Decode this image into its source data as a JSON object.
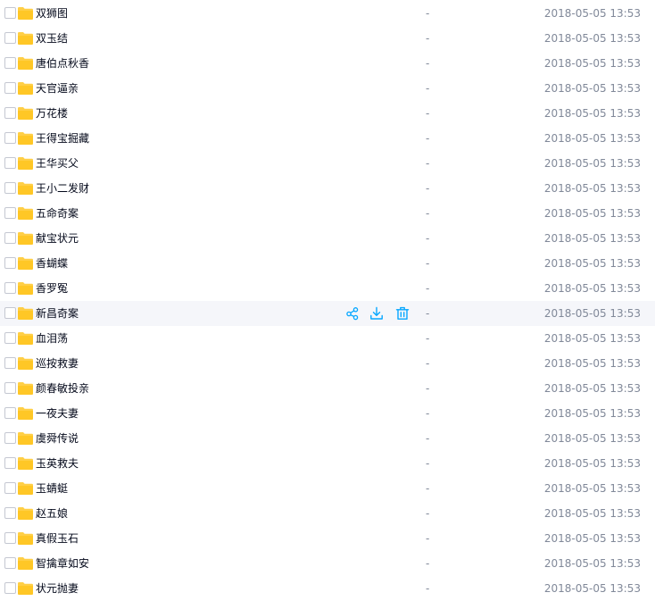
{
  "colors": {
    "folder": "#ffc726",
    "row_hover": "#f5f6fa",
    "text": "#03081a",
    "muted_text": "#818999",
    "action_icon": "#06a7ff"
  },
  "hover_actions": [
    {
      "name": "share-icon"
    },
    {
      "name": "download-icon"
    },
    {
      "name": "delete-icon"
    }
  ],
  "rows": [
    {
      "name": "双狮图",
      "size": "-",
      "date": "2018-05-05 13:53"
    },
    {
      "name": "双玉结",
      "size": "-",
      "date": "2018-05-05 13:53"
    },
    {
      "name": "唐伯点秋香",
      "size": "-",
      "date": "2018-05-05 13:53"
    },
    {
      "name": "天官逼亲",
      "size": "-",
      "date": "2018-05-05 13:53"
    },
    {
      "name": "万花楼",
      "size": "-",
      "date": "2018-05-05 13:53"
    },
    {
      "name": "王得宝掘藏",
      "size": "-",
      "date": "2018-05-05 13:53"
    },
    {
      "name": "王华买父",
      "size": "-",
      "date": "2018-05-05 13:53"
    },
    {
      "name": "王小二发财",
      "size": "-",
      "date": "2018-05-05 13:53"
    },
    {
      "name": "五命奇案",
      "size": "-",
      "date": "2018-05-05 13:53"
    },
    {
      "name": "献宝状元",
      "size": "-",
      "date": "2018-05-05 13:53"
    },
    {
      "name": "香蝴蝶",
      "size": "-",
      "date": "2018-05-05 13:53"
    },
    {
      "name": "香罗冤",
      "size": "-",
      "date": "2018-05-05 13:53"
    },
    {
      "name": "新昌奇案",
      "size": "-",
      "date": "2018-05-05 13:53",
      "hovered": true
    },
    {
      "name": "血泪荡",
      "size": "-",
      "date": "2018-05-05 13:53"
    },
    {
      "name": "巡按救妻",
      "size": "-",
      "date": "2018-05-05 13:53"
    },
    {
      "name": "颜春敏投亲",
      "size": "-",
      "date": "2018-05-05 13:53"
    },
    {
      "name": "一夜夫妻",
      "size": "-",
      "date": "2018-05-05 13:53"
    },
    {
      "name": "虞舜传说",
      "size": "-",
      "date": "2018-05-05 13:53"
    },
    {
      "name": "玉英救夫",
      "size": "-",
      "date": "2018-05-05 13:53"
    },
    {
      "name": "玉蜻蜓",
      "size": "-",
      "date": "2018-05-05 13:53"
    },
    {
      "name": "赵五娘",
      "size": "-",
      "date": "2018-05-05 13:53"
    },
    {
      "name": "真假玉石",
      "size": "-",
      "date": "2018-05-05 13:53"
    },
    {
      "name": "智擒章如安",
      "size": "-",
      "date": "2018-05-05 13:53"
    },
    {
      "name": "状元抛妻",
      "size": "-",
      "date": "2018-05-05 13:53"
    }
  ]
}
